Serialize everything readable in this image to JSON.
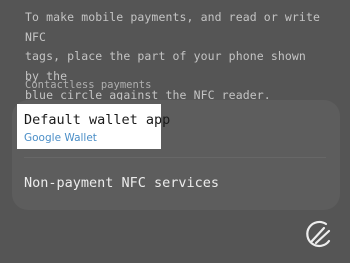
{
  "intro": {
    "lines": [
      "To make mobile payments, and read or write NFC",
      "tags, place the part of your phone shown by the",
      "blue circle against the NFC reader."
    ]
  },
  "contactless": {
    "header": "Contactless payments",
    "default_wallet": {
      "title": "Default wallet app",
      "value": "Google Wallet"
    },
    "non_payment": {
      "title": "Non-payment NFC services"
    }
  },
  "colors": {
    "background": "#555555",
    "card": "#5d5d5d",
    "highlight": "#ffffff",
    "accent": "#4a8ec7"
  },
  "watermark": {
    "icon": "site-logo-icon"
  }
}
